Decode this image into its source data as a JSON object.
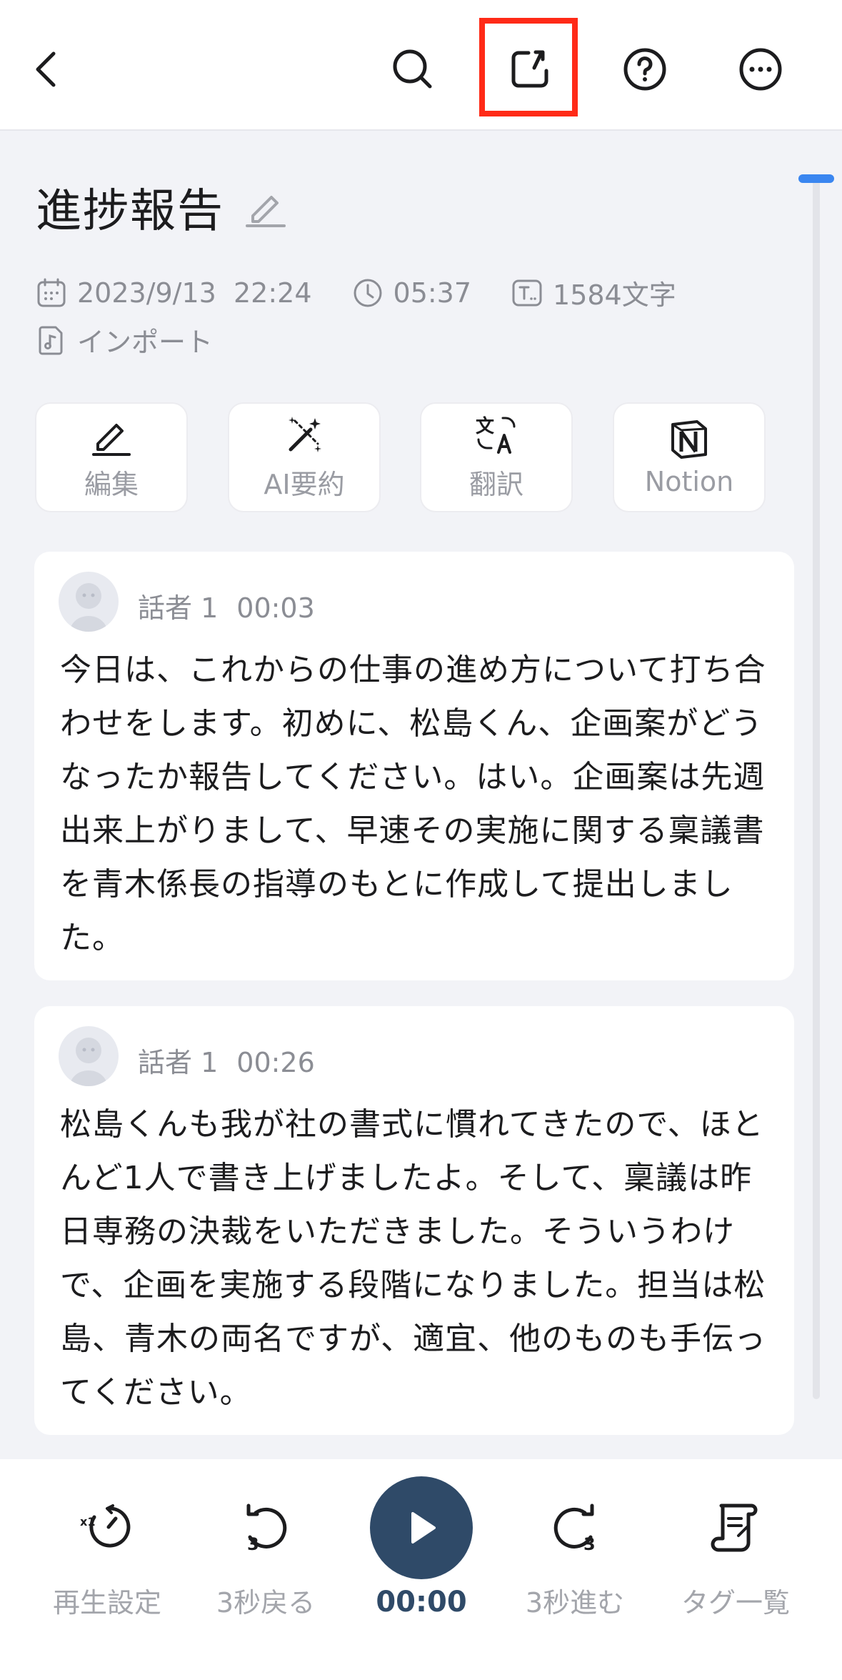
{
  "header": {
    "back_icon": "chevron-left-icon",
    "search_icon": "search-icon",
    "share_icon": "share-export-icon",
    "help_icon": "help-circle-icon",
    "more_icon": "more-horizontal-icon",
    "highlight_color": "#ff2a17"
  },
  "title": "進捗報告",
  "meta": {
    "date": "2023/9/13  22:24",
    "duration": "05:37",
    "char_count": "1584文字",
    "source": "インポート"
  },
  "actions": [
    {
      "label": "編集",
      "icon": "pencil-icon"
    },
    {
      "label": "AI要約",
      "icon": "magic-wand-icon"
    },
    {
      "label": "翻訳",
      "icon": "translate-icon"
    },
    {
      "label": "Notion",
      "icon": "notion-icon"
    }
  ],
  "transcript": [
    {
      "speaker": "話者 1",
      "time": "00:03",
      "text": "今日は、これからの仕事の進め方について打ち合わせをします。初めに、松島くん、企画案がどうなったか報告してください。はい。企画案は先週出来上がりまして、早速その実施に関する稟議書を青木係長の指導のもとに作成して提出しました。"
    },
    {
      "speaker": "話者 1",
      "time": "00:26",
      "text": "松島くんも我が社の書式に慣れてきたので、ほとんど1人で書き上げましたよ。そして、稟議は昨日専務の決裁をいただきました。そういうわけで、企画を実施する段階になりました。担当は松島、青木の両名ですが、適宜、他のものも手伝ってください。"
    }
  ],
  "player": {
    "speed_label": "再生設定",
    "speed_badge": "x1",
    "back_label": "3秒戻る",
    "back_badge": "3",
    "time": "00:00",
    "forward_label": "3秒進む",
    "forward_badge": "3",
    "tags_label": "タグ一覧",
    "accent_color": "#2f4a68"
  }
}
